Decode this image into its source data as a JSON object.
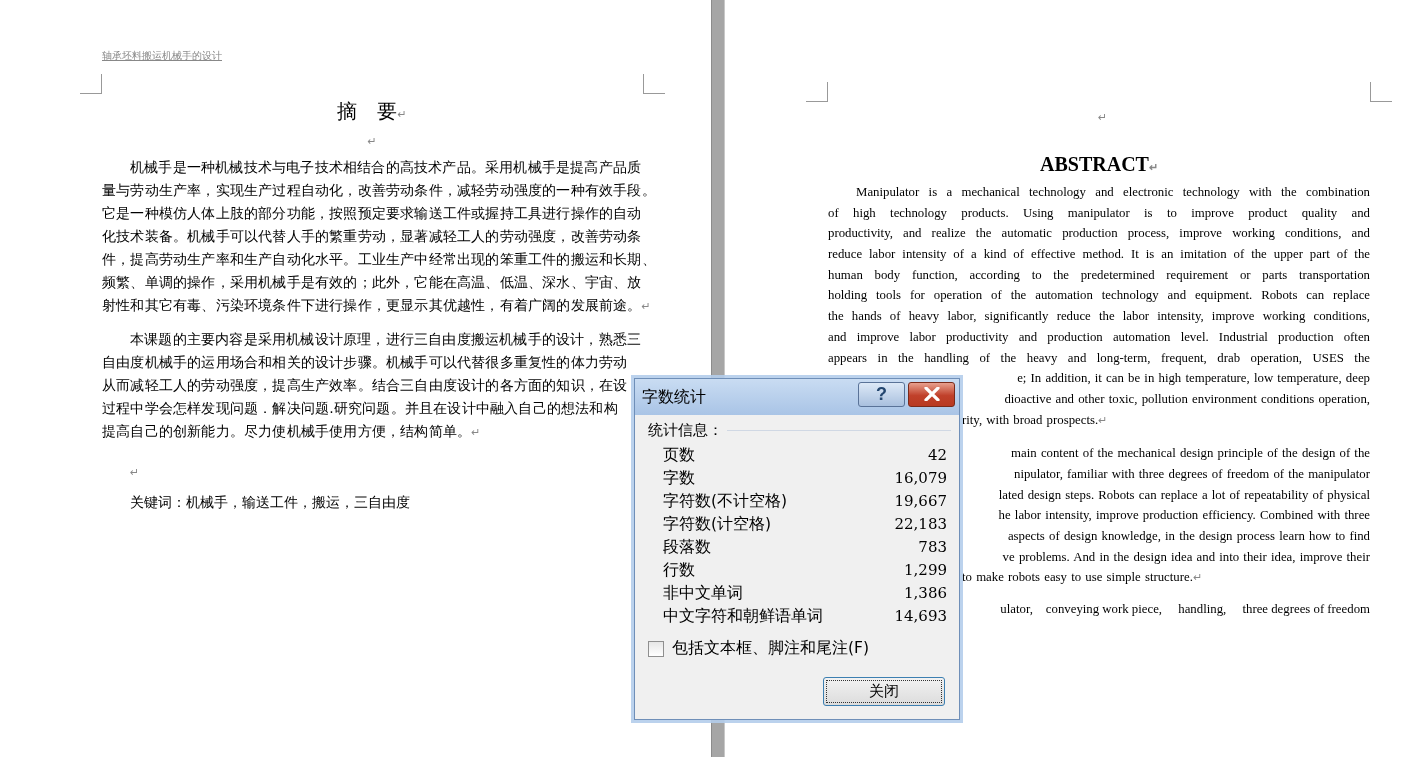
{
  "left_page": {
    "header": "轴承坯料搬运机械手的设计",
    "title": "摘　要",
    "title_mark": "↵",
    "blank_mark": "↵",
    "paragraphs": [
      {
        "lines": [
          "机械手是一种机械技术与电子技术相结合的高技术产品。采用机械手是提高产品质",
          "量与劳动生产率，实现生产过程自动化，改善劳动条件，减轻劳动强度的一种有效手段。",
          "它是一种模仿人体上肢的部分功能，按照预定要求输送工件或握持工具进行操作的自动",
          "化技术装备。机械手可以代替人手的繁重劳动，显著减轻工人的劳动强度，改善劳动条",
          "件，提高劳动生产率和生产自动化水平。工业生产中经常出现的笨重工件的搬运和长期、",
          "频繁、单调的操作，采用机械手是有效的；此外，它能在高温、低温、深水、宇宙、放",
          "射性和其它有毒、污染环境条件下进行操作，更显示其优越性，有着广阔的发展前途。"
        ],
        "end_mark": "↵"
      },
      {
        "lines": [
          "本课题的主要内容是采用机械设计原理，进行三自由度搬运机械手的设计，熟悉三",
          "自由度机械手的运用场合和相关的设计步骤。机械手可以代替很多重复性的体力劳动",
          "从而减轻工人的劳动强度，提高生产效率。结合三自由度设计的各方面的知识，在设",
          "过程中学会怎样发现问题．解决问题.研究问题。并且在设计中融入自己的想法和构",
          "提高自己的创新能力。尽力使机械手使用方便，结构简单。"
        ],
        "end_mark": "↵"
      }
    ],
    "blank_mark_2": "↵",
    "keywords": "关键词：机械手，输送工件，搬运，三自由度"
  },
  "right_page": {
    "top_mark": "↵",
    "title": "ABSTRACT",
    "title_mark": "↵",
    "paragraphs": [
      {
        "lines": [
          "Manipulator is a mechanical technology and electronic technology with the combination",
          "of high technology products. Using manipulator is to improve product quality and",
          "productivity, and realize the automatic production process, improve working conditions, and",
          "reduce labor intensity of a kind of effective method. It is an imitation of the upper part of the",
          "human body function, according to the predetermined requirement or parts transportation",
          "holding tools for operation of the automation technology and equipment. Robots can replace",
          "the hands of heavy labor, significantly reduce the labor intensity, improve working conditions,",
          "and improve labor productivity and production automation level. Industrial production often",
          "appears in the handling of the heavy and long-term, frequent, drab operation, USES the"
        ],
        "visible_line_ends": [
          "e; In addition, it can be in high temperature, low temperature, deep",
          "dioactive and other toxic, pollution environment conditions operation,",
          "rity, with broad prospects."
        ],
        "end_mark": "↵"
      },
      {
        "visible_line_ends": [
          "main content of the mechanical design principle of the design of the",
          "nipulator, familiar with three degrees of freedom of the manipulator",
          "lated design steps. Robots can replace a lot of repeatability of physical",
          "he labor intensity, improve production efficiency. Combined with three",
          "aspects of design knowledge, in the design process learn how to find",
          "ve problems. And in the design idea and into their idea, improve their",
          "to make robots easy to use simple structure."
        ],
        "end_mark": "↵"
      }
    ],
    "keywords": "ulator,　conveying work piece,　 handling,　 three degrees of freedom"
  },
  "dialog": {
    "title": "字数统计",
    "help": "?",
    "group_label": "统计信息：",
    "stats": [
      {
        "label": "页数",
        "value": "42"
      },
      {
        "label": "字数",
        "value": "16,079"
      },
      {
        "label": "字符数(不计空格)",
        "value": "19,667"
      },
      {
        "label": "字符数(计空格)",
        "value": "22,183"
      },
      {
        "label": "段落数",
        "value": "783"
      },
      {
        "label": "行数",
        "value": "1,299"
      },
      {
        "label": "非中文单词",
        "value": "1,386"
      },
      {
        "label": "中文字符和朝鲜语单词",
        "value": "14,693"
      }
    ],
    "include_option": {
      "label": "包括文本框、脚注和尾注(F)",
      "checked": false
    },
    "close_button": "关闭"
  }
}
